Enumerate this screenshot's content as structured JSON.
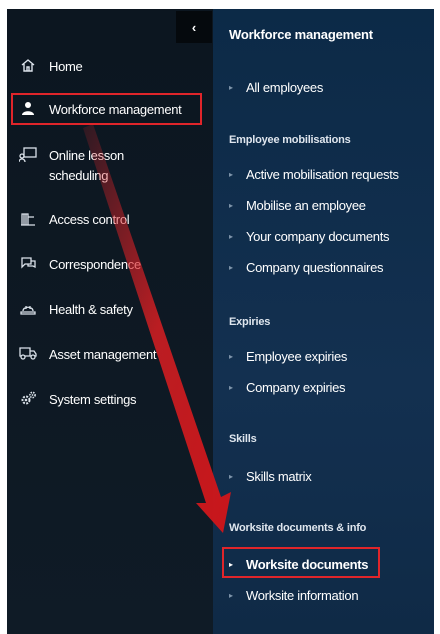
{
  "nav": {
    "collapse_glyph": "‹",
    "items": [
      {
        "label": "Home",
        "icon": "home-icon"
      },
      {
        "label": "Workforce management",
        "icon": "person-icon"
      },
      {
        "label": "Online lesson scheduling",
        "icon": "presentation-icon"
      },
      {
        "label": "Access control",
        "icon": "gate-icon"
      },
      {
        "label": "Correspondence",
        "icon": "chat-icon"
      },
      {
        "label": "Health & safety",
        "icon": "hardhat-icon"
      },
      {
        "label": "Asset management",
        "icon": "truck-icon"
      },
      {
        "label": "System settings",
        "icon": "gears-icon"
      }
    ],
    "active_index": 1
  },
  "panel": {
    "title": "Workforce management",
    "all_employees": "All employees",
    "sections": [
      {
        "header": "Employee mobilisations",
        "links": [
          "Active mobilisation requests",
          "Mobilise an employee",
          "Your company documents",
          "Company questionnaires"
        ]
      },
      {
        "header": "Expiries",
        "links": [
          "Employee expiries",
          "Company expiries"
        ]
      },
      {
        "header": "Skills",
        "links": [
          "Skills matrix"
        ]
      },
      {
        "header": "Worksite documents & info",
        "links": [
          "Worksite documents",
          "Worksite information"
        ]
      }
    ],
    "active_link": "Worksite documents"
  },
  "colors": {
    "nav_bg": "#0c1620",
    "panel_bg": "#0c2a47",
    "highlight": "#e0252a",
    "arrow": "#d81e22"
  }
}
